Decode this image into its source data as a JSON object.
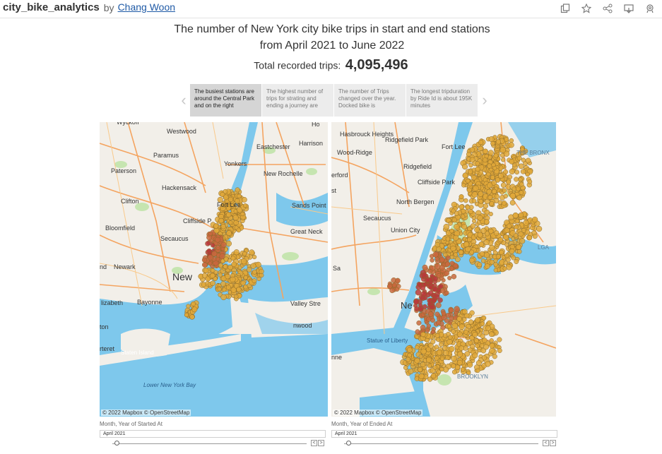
{
  "header": {
    "title": "city_bike_analytics",
    "by": "by",
    "author": "Chang Woon",
    "icons": [
      "duplicate-icon",
      "star-icon",
      "share-icon",
      "download-icon",
      "settings-icon"
    ]
  },
  "dashboard": {
    "title_line1": "The number of New York city bike trips in start and end stations",
    "title_line2": "from April 2021 to June 2022",
    "total_label": "Total recorded trips:",
    "total_value": "4,095,496"
  },
  "story": {
    "points": [
      "The busiest stations are around the Central Park and on the right",
      "The highest number of trips for strating and ending a journey are",
      "The number of Trips changed over the year. Docked bike is",
      "The longest tripduration by Ride Id is about 195K minutes"
    ],
    "active_index": 0
  },
  "maps": {
    "left": {
      "attribution": "© 2022 Mapbox © OpenStreetMap",
      "labels": [
        "Westwood",
        "Harrison",
        "Eastchester",
        "Paramus",
        "Yonkers",
        "Paterson",
        "New Rochelle",
        "Hackensack",
        "Clifton",
        "Fort Lee",
        "Sands Point",
        "Cliffside P",
        "Bloomfield",
        "Great Neck",
        "Secaucus",
        "Newark",
        "New",
        "Bayonne",
        "Valley Stre",
        "lizabeth",
        "Staten Island",
        "Lower New York Bay",
        "rteret",
        "nwood",
        "ton",
        "nd",
        "Wyckoff",
        "Ho"
      ]
    },
    "right": {
      "attribution": "© 2022 Mapbox © OpenStreetMap",
      "labels": [
        "Hasbrouck Heights",
        "Ridgefield Park",
        "Wood-Ridge",
        "Fort Lee",
        "THE BRONX",
        "erford",
        "Ridgefield",
        "Cliffside Park",
        "North Bergen",
        "Secaucus",
        "Union City",
        "LGA",
        "Ne",
        "Statue of Liberty",
        "nne",
        "BROOKLYN",
        "st",
        "Sa"
      ]
    }
  },
  "filters": {
    "start": {
      "label": "Month, Year of Started At",
      "value": "April 2021"
    },
    "end": {
      "label": "Month, Year of Ended At",
      "value": "April 2021"
    }
  },
  "colors": {
    "water": "#7ec8ec",
    "land": "#f2efe9",
    "park": "#c6e5b0",
    "highway": "#f4a460",
    "dot_fill": "#e1a83a",
    "dot_dense": "#c9683e",
    "dot_hot": "#b8383a",
    "author_link": "#1f5aa6"
  }
}
